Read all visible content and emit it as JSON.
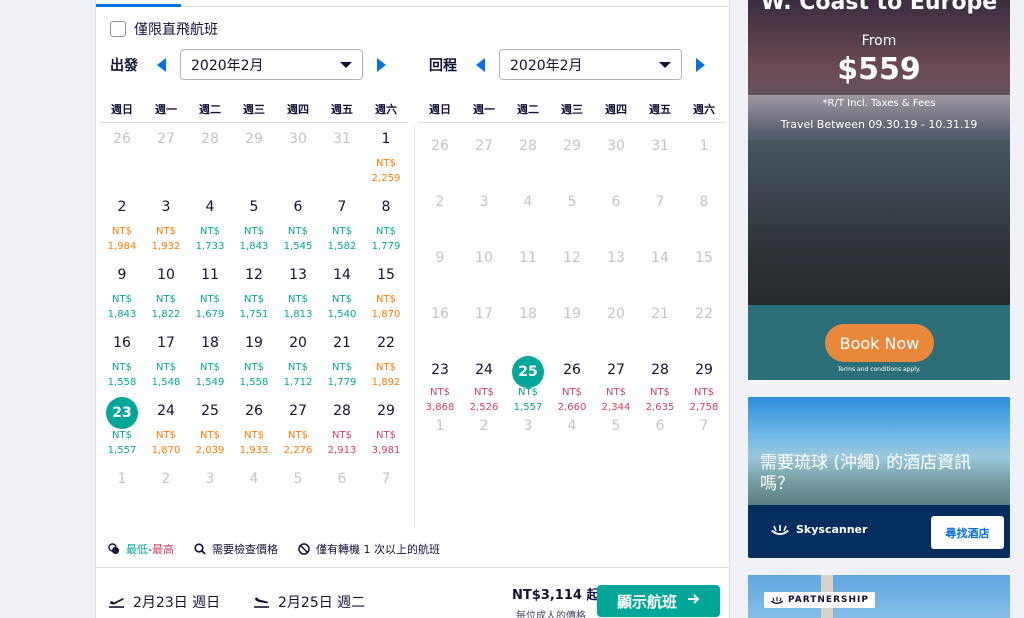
{
  "filter": {
    "direct_only_label": "僅限直飛航班"
  },
  "depart": {
    "label": "出發",
    "month": "2020年2月"
  },
  "return": {
    "label": "回程",
    "month": "2020年2月"
  },
  "weekdays": [
    "週日",
    "週一",
    "週二",
    "週三",
    "週四",
    "週五",
    "週六"
  ],
  "outbound_days": [
    {
      "d": "26",
      "out": true
    },
    {
      "d": "27",
      "out": true
    },
    {
      "d": "28",
      "out": true
    },
    {
      "d": "29",
      "out": true
    },
    {
      "d": "30",
      "out": true
    },
    {
      "d": "31",
      "out": true
    },
    {
      "d": "1",
      "cur": "NT$",
      "p": "2,259",
      "c": "mid"
    },
    {
      "d": "2",
      "cur": "NT$",
      "p": "1,984",
      "c": "mid"
    },
    {
      "d": "3",
      "cur": "NT$",
      "p": "1,932",
      "c": "mid"
    },
    {
      "d": "4",
      "cur": "NT$",
      "p": "1,733",
      "c": "low"
    },
    {
      "d": "5",
      "cur": "NT$",
      "p": "1,843",
      "c": "low"
    },
    {
      "d": "6",
      "cur": "NT$",
      "p": "1,545",
      "c": "low"
    },
    {
      "d": "7",
      "cur": "NT$",
      "p": "1,582",
      "c": "low"
    },
    {
      "d": "8",
      "cur": "NT$",
      "p": "1,779",
      "c": "low"
    },
    {
      "d": "9",
      "cur": "NT$",
      "p": "1,843",
      "c": "low"
    },
    {
      "d": "10",
      "cur": "NT$",
      "p": "1,822",
      "c": "low"
    },
    {
      "d": "11",
      "cur": "NT$",
      "p": "1,679",
      "c": "low"
    },
    {
      "d": "12",
      "cur": "NT$",
      "p": "1,751",
      "c": "low"
    },
    {
      "d": "13",
      "cur": "NT$",
      "p": "1,813",
      "c": "low"
    },
    {
      "d": "14",
      "cur": "NT$",
      "p": "1,540",
      "c": "low"
    },
    {
      "d": "15",
      "cur": "NT$",
      "p": "1,870",
      "c": "mid"
    },
    {
      "d": "16",
      "cur": "NT$",
      "p": "1,558",
      "c": "low"
    },
    {
      "d": "17",
      "cur": "NT$",
      "p": "1,548",
      "c": "low"
    },
    {
      "d": "18",
      "cur": "NT$",
      "p": "1,549",
      "c": "low"
    },
    {
      "d": "19",
      "cur": "NT$",
      "p": "1,558",
      "c": "low"
    },
    {
      "d": "20",
      "cur": "NT$",
      "p": "1,712",
      "c": "low"
    },
    {
      "d": "21",
      "cur": "NT$",
      "p": "1,779",
      "c": "low"
    },
    {
      "d": "22",
      "cur": "NT$",
      "p": "1,892",
      "c": "mid"
    },
    {
      "d": "23",
      "cur": "NT$",
      "p": "1,557",
      "c": "low",
      "sel": true
    },
    {
      "d": "24",
      "cur": "NT$",
      "p": "1,870",
      "c": "mid"
    },
    {
      "d": "25",
      "cur": "NT$",
      "p": "2,039",
      "c": "mid"
    },
    {
      "d": "26",
      "cur": "NT$",
      "p": "1,933",
      "c": "mid"
    },
    {
      "d": "27",
      "cur": "NT$",
      "p": "2,276",
      "c": "mid"
    },
    {
      "d": "28",
      "cur": "NT$",
      "p": "2,913",
      "c": "high"
    },
    {
      "d": "29",
      "cur": "NT$",
      "p": "3,981",
      "c": "high"
    },
    {
      "d": "1",
      "out": true
    },
    {
      "d": "2",
      "out": true
    },
    {
      "d": "3",
      "out": true
    },
    {
      "d": "4",
      "out": true
    },
    {
      "d": "5",
      "out": true
    },
    {
      "d": "6",
      "out": true
    },
    {
      "d": "7",
      "out": true
    }
  ],
  "return_days": [
    {
      "d": "26",
      "out": true
    },
    {
      "d": "27",
      "out": true
    },
    {
      "d": "28",
      "out": true
    },
    {
      "d": "29",
      "out": true
    },
    {
      "d": "30",
      "out": true
    },
    {
      "d": "31",
      "out": true
    },
    {
      "d": "1",
      "out": true
    },
    {
      "d": "2",
      "out": true
    },
    {
      "d": "3",
      "out": true
    },
    {
      "d": "4",
      "out": true
    },
    {
      "d": "5",
      "out": true
    },
    {
      "d": "6",
      "out": true
    },
    {
      "d": "7",
      "out": true
    },
    {
      "d": "8",
      "out": true
    },
    {
      "d": "9",
      "out": true
    },
    {
      "d": "10",
      "out": true
    },
    {
      "d": "11",
      "out": true
    },
    {
      "d": "12",
      "out": true
    },
    {
      "d": "13",
      "out": true
    },
    {
      "d": "14",
      "out": true
    },
    {
      "d": "15",
      "out": true
    },
    {
      "d": "16",
      "out": true
    },
    {
      "d": "17",
      "out": true
    },
    {
      "d": "18",
      "out": true
    },
    {
      "d": "19",
      "out": true
    },
    {
      "d": "20",
      "out": true
    },
    {
      "d": "21",
      "out": true
    },
    {
      "d": "22",
      "out": true
    },
    {
      "d": "23",
      "cur": "NT$",
      "p": "3,868",
      "c": "high"
    },
    {
      "d": "24",
      "cur": "NT$",
      "p": "2,526",
      "c": "high"
    },
    {
      "d": "25",
      "cur": "NT$",
      "p": "1,557",
      "c": "low",
      "sel": true
    },
    {
      "d": "26",
      "cur": "NT$",
      "p": "2,660",
      "c": "high"
    },
    {
      "d": "27",
      "cur": "NT$",
      "p": "2,344",
      "c": "high"
    },
    {
      "d": "28",
      "cur": "NT$",
      "p": "2,635",
      "c": "high"
    },
    {
      "d": "29",
      "cur": "NT$",
      "p": "2,758",
      "c": "high"
    },
    {
      "d": "1",
      "out": true
    },
    {
      "d": "2",
      "out": true
    },
    {
      "d": "3",
      "out": true
    },
    {
      "d": "4",
      "out": true
    },
    {
      "d": "5",
      "out": true
    },
    {
      "d": "6",
      "out": true
    },
    {
      "d": "7",
      "out": true
    }
  ],
  "legend": {
    "low": "最低",
    "sep": " - ",
    "high": "最高",
    "check_price": "需要檢查價格",
    "connections": "僅有轉機 1 次以上的航班"
  },
  "footer": {
    "depart_date": "2月23日 週日",
    "return_date": "2月25日 週二",
    "price": "NT$3,114 起",
    "per_adult": "每位成人的價格",
    "show_flights": "顯示航班"
  },
  "ads": {
    "ad1": {
      "title": "W. Coast to Europe",
      "from": "From",
      "price": "$559",
      "note": "*R/T Incl. Taxes & Fees",
      "travel": "Travel Between 09.30.19 - 10.31.19",
      "book": "Book Now",
      "terms": "Terms and conditions apply."
    },
    "ad2": {
      "text": "需要琉球 (沖繩) 的酒店資訊嗎？",
      "brand": "Skyscanner",
      "button": "尋找酒店"
    },
    "ad3": {
      "tag": "PARTNERSHIP"
    }
  },
  "colors": {
    "accent": "#0770e3",
    "low": "#00a698",
    "mid": "#ff7b00",
    "high": "#d1435b"
  }
}
